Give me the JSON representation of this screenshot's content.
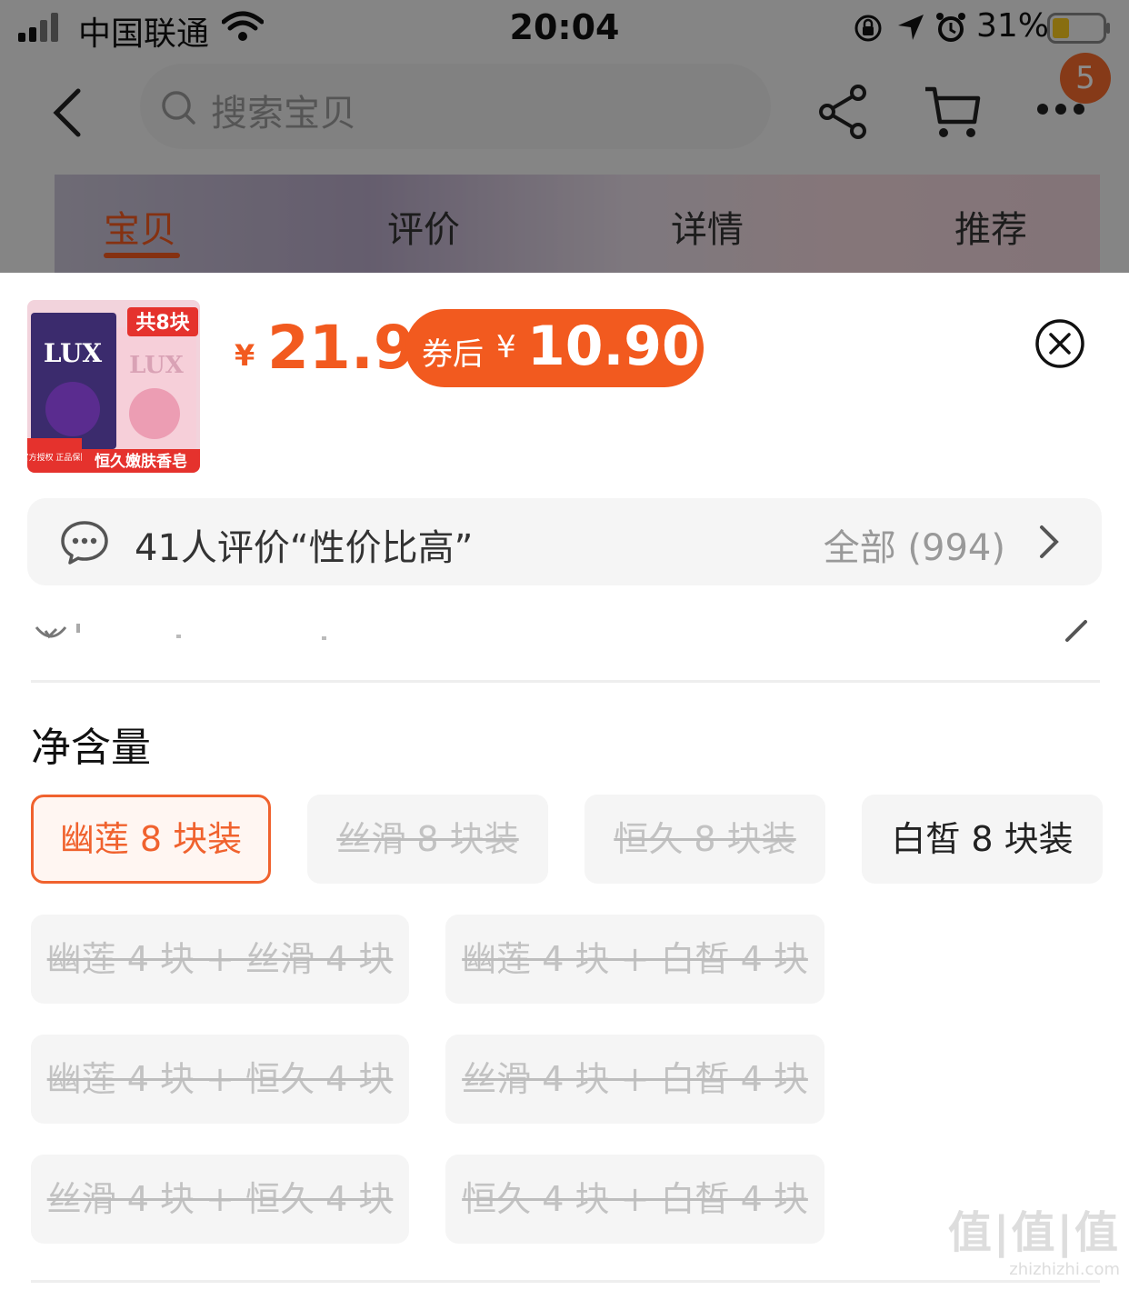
{
  "status_bar": {
    "carrier": "中国联通",
    "time": "20:04",
    "battery": "31%"
  },
  "nav": {
    "search_placeholder": "搜索宝贝",
    "badge_count": "5"
  },
  "tabs": [
    {
      "label": "宝贝",
      "active": true
    },
    {
      "label": "评价",
      "active": false
    },
    {
      "label": "详情",
      "active": false
    },
    {
      "label": "推荐",
      "active": false
    }
  ],
  "product": {
    "thumb_texts": {
      "badge": "共8块",
      "brand": "LUX",
      "corner": "官方授权 正品保障",
      "caption": "恒久嫩肤香皂"
    },
    "currency": "¥",
    "price": "21.9",
    "coupon_label": "券后",
    "coupon_currency": "¥",
    "coupon_price": "10.90"
  },
  "review_bar": {
    "summary": "41人评价“性价比高”",
    "all_label": "全部 (994)"
  },
  "spec": {
    "title": "净含量",
    "options": [
      {
        "label": "幽莲 8 块装",
        "state": "selected"
      },
      {
        "label": "丝滑 8 块装",
        "state": "disabled"
      },
      {
        "label": "恒久 8 块装",
        "state": "disabled"
      },
      {
        "label": "白皙 8 块装",
        "state": "available"
      },
      {
        "label": "幽莲 4 块 + 丝滑 4 块",
        "state": "disabled"
      },
      {
        "label": "幽莲 4 块 + 白皙 4 块",
        "state": "disabled"
      },
      {
        "label": "幽莲 4 块 + 恒久 4 块",
        "state": "disabled"
      },
      {
        "label": "丝滑 4 块 + 白皙 4 块",
        "state": "disabled"
      },
      {
        "label": "丝滑 4 块 + 恒久 4 块",
        "state": "disabled"
      },
      {
        "label": "恒久 4 块 + 白皙 4 块",
        "state": "disabled"
      }
    ]
  },
  "watermark": {
    "line1": "值|值|值",
    "line2": "zhizhizhi.com"
  },
  "colors": {
    "accent": "#f25a1f",
    "chip_bg": "#f5f5f5",
    "disabled_text": "#c2c2c2"
  }
}
